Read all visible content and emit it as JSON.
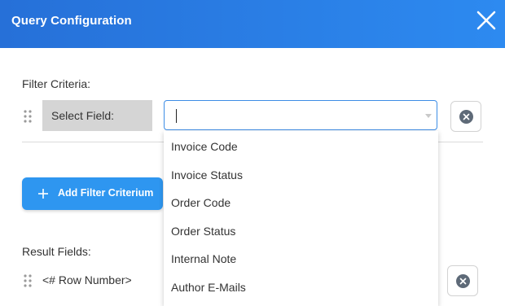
{
  "header": {
    "title": "Query Configuration"
  },
  "filter": {
    "section_label": "Filter Criteria:",
    "field_label": "Select Field:",
    "input_value": "",
    "options": [
      "Invoice Code",
      "Invoice Status",
      "Order Code",
      "Order Status",
      "Internal Note",
      "Author E-Mails"
    ]
  },
  "add_button": {
    "label": "Add Filter Criterium"
  },
  "results": {
    "section_label": "Result Fields:",
    "rows": [
      {
        "label": "<# Row Number>"
      }
    ]
  },
  "colors": {
    "header_start": "#2670d8",
    "header_end": "#2d8af0",
    "accent": "#2e96f0",
    "input_border": "#3d8de6"
  },
  "icons": [
    "close-icon",
    "drag-handle-icon",
    "clear-icon",
    "chevron-down-icon",
    "plus-icon"
  ]
}
